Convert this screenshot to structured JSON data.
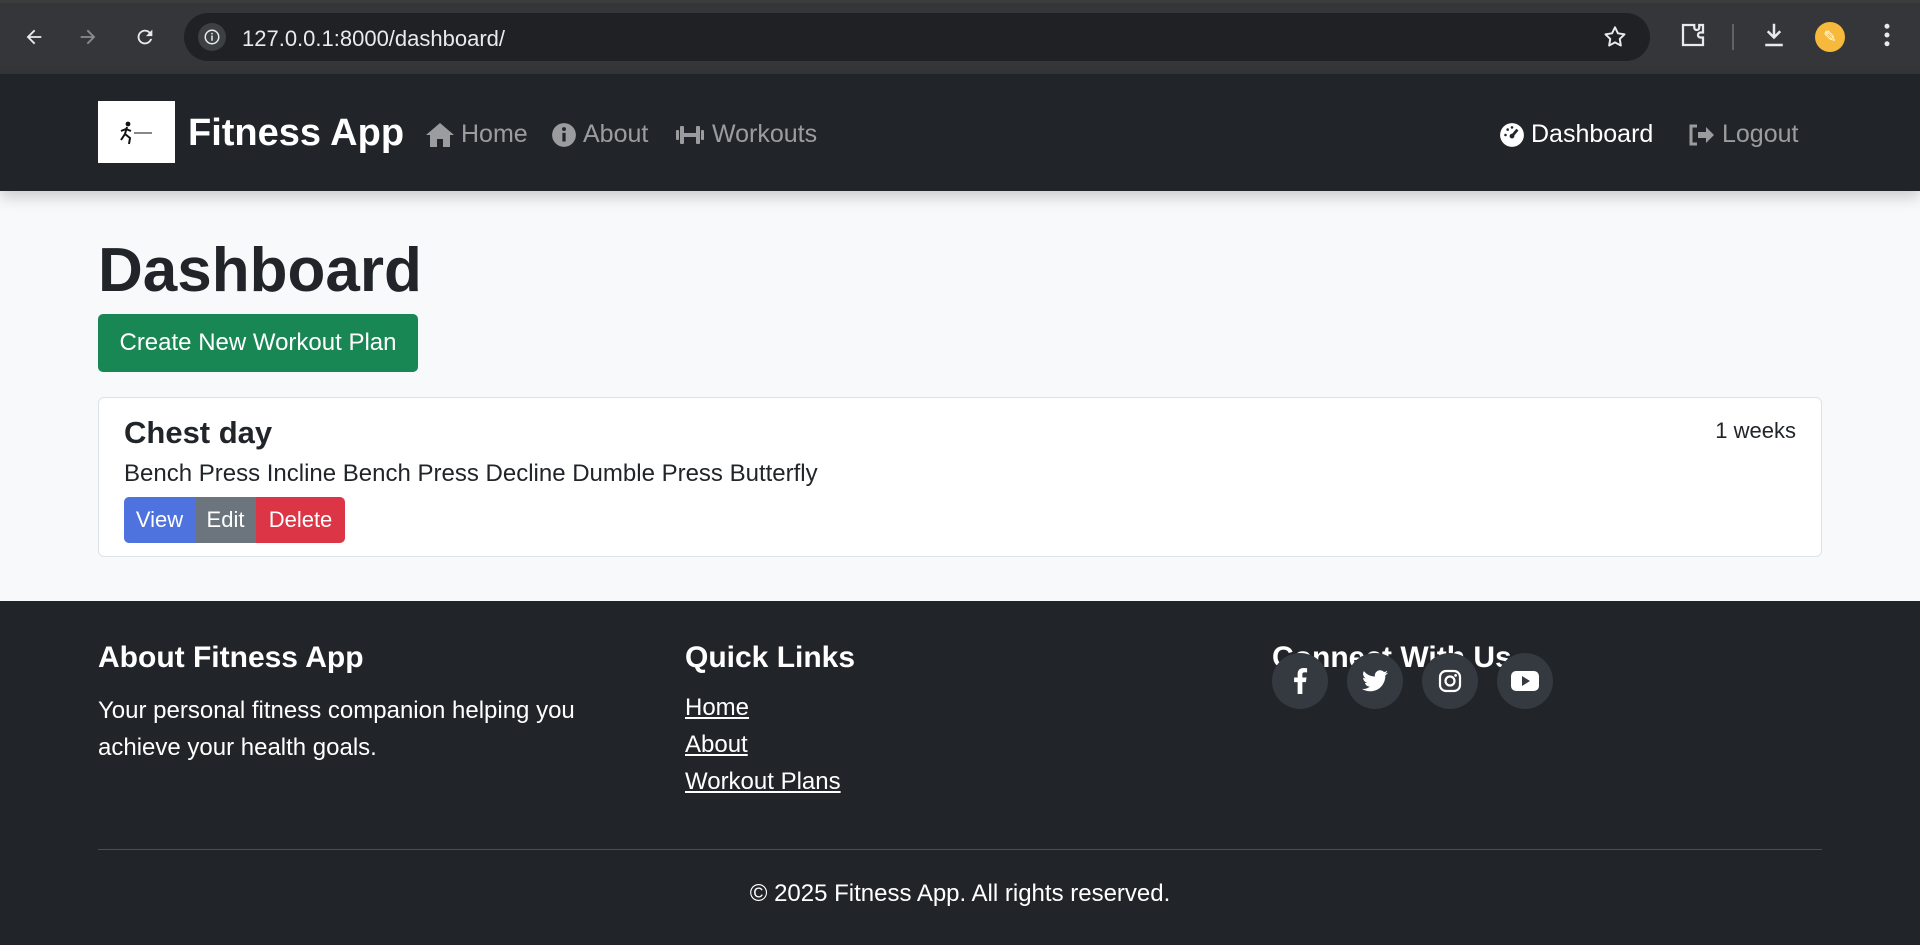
{
  "browser": {
    "url": "127.0.0.1:8000/dashboard/"
  },
  "navbar": {
    "brand": "Fitness App",
    "links": [
      {
        "label": "Home"
      },
      {
        "label": "About"
      },
      {
        "label": "Workouts"
      }
    ],
    "right_links": [
      {
        "label": "Dashboard",
        "active": true
      },
      {
        "label": "Logout"
      }
    ]
  },
  "main": {
    "title": "Dashboard",
    "create_button": "Create New Workout Plan",
    "plans": [
      {
        "title": "Chest day",
        "duration": "1 weeks",
        "exercises": "Bench Press Incline Bench Press Decline Dumble Press Butterfly",
        "actions": {
          "view": "View",
          "edit": "Edit",
          "delete": "Delete"
        }
      }
    ]
  },
  "footer": {
    "about_heading": "About Fitness App",
    "about_text": "Your personal fitness companion helping you achieve your health goals.",
    "links_heading": "Quick Links",
    "links": [
      "Home",
      "About",
      "Workout Plans"
    ],
    "social_heading": "Connect With Us",
    "social_icons": [
      "facebook-icon",
      "twitter-icon",
      "instagram-icon",
      "youtube-icon"
    ],
    "copyright": "© 2025 Fitness App. All rights reserved."
  },
  "colors": {
    "navbar_bg": "#212529",
    "success": "#198754",
    "primary": "#4e73df",
    "secondary": "#6c757d",
    "danger": "#dc3545"
  }
}
